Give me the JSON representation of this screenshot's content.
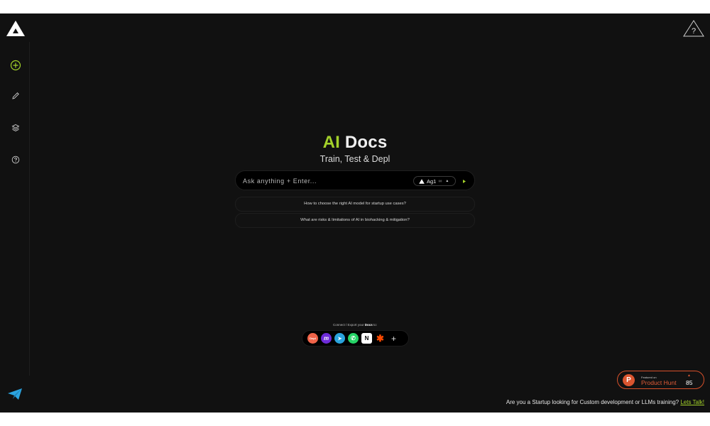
{
  "sidebar": {
    "logo_icon": "triangle-logo-icon",
    "items": [
      {
        "name": "new-chat",
        "icon": "plus-circle-icon"
      },
      {
        "name": "edit",
        "icon": "pencil-icon"
      },
      {
        "name": "layers",
        "icon": "layers-icon"
      },
      {
        "name": "help",
        "icon": "question-circle-icon"
      }
    ],
    "bottom_icon": "paper-plane-icon"
  },
  "header": {
    "warning_icon": "question-triangle-icon"
  },
  "main": {
    "title_accent": "AI",
    "title_rest": "Docs",
    "subtitle": "Train, Test & Depl",
    "search": {
      "placeholder": "Ask anything + Enter...",
      "model_label": "Ag1",
      "model_suffix": "∞"
    },
    "suggestions": [
      "How to choose the right AI model for startup use cases?",
      "What are risks & limitations of AI in biohacking & mitigation?"
    ]
  },
  "connect": {
    "label_prefix": "Connect / Export your",
    "label_bold": "Docs",
    "label_suffix": "to:",
    "integrations": [
      {
        "name": "depl",
        "text": "Depl",
        "color": "#f06449"
      },
      {
        "name": "make",
        "text": "m",
        "color": "#6d2bd9"
      },
      {
        "name": "telegram",
        "text": "➤",
        "color": "#2aa3dd"
      },
      {
        "name": "whatsapp",
        "text": "✆",
        "color": "#25d366"
      },
      {
        "name": "notion",
        "text": "N",
        "color": "#ffffff"
      },
      {
        "name": "zapier",
        "text": "✱",
        "color": "#ff4a00"
      }
    ],
    "plus": "+"
  },
  "product_hunt": {
    "small_label": "Featured on",
    "name": "Product Hunt",
    "upvotes": "85",
    "arrow": "▲",
    "logo_letter": "P"
  },
  "footer": {
    "text": "Are you a Startup looking for Custom development or LLMs training?",
    "link": "Lets Talk!"
  },
  "colors": {
    "accent": "#a3d12a",
    "background": "#111111",
    "product_hunt": "#da552f"
  }
}
